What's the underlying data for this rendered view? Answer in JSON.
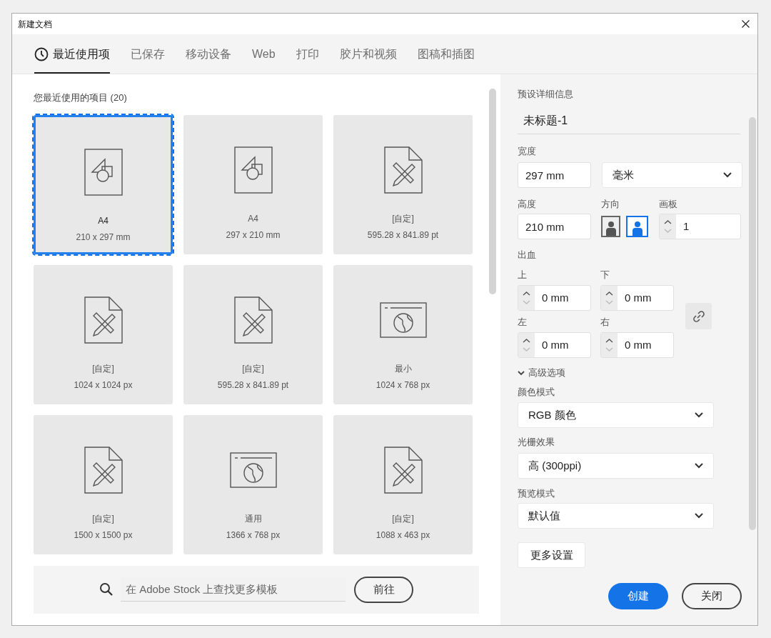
{
  "window": {
    "title": "新建文档"
  },
  "tabs": [
    {
      "label": "最近使用项",
      "selected": true,
      "kind": "recent"
    },
    {
      "label": "已保存",
      "selected": false,
      "kind": "category"
    },
    {
      "label": "移动设备",
      "selected": false,
      "kind": "category"
    },
    {
      "label": "Web",
      "selected": false,
      "kind": "category"
    },
    {
      "label": "打印",
      "selected": false,
      "kind": "category"
    },
    {
      "label": "胶片和视频",
      "selected": false,
      "kind": "category"
    },
    {
      "label": "图稿和插图",
      "selected": false,
      "kind": "category"
    }
  ],
  "recent": {
    "heading": "您最近使用的项目 (20)",
    "items": [
      {
        "kind": "shapes",
        "name": "A4",
        "size": "210 x 297 mm",
        "selected": true
      },
      {
        "kind": "shapes",
        "name": "A4",
        "size": "297 x 210 mm",
        "selected": false
      },
      {
        "kind": "custom",
        "name": "[自定]",
        "size": "595.28 x 841.89 pt",
        "selected": false
      },
      {
        "kind": "custom",
        "name": "[自定]",
        "size": "1024 x 1024 px",
        "selected": false
      },
      {
        "kind": "custom",
        "name": "[自定]",
        "size": "595.28 x 841.89 pt",
        "selected": false
      },
      {
        "kind": "web",
        "name": "最小",
        "size": "1024 x 768 px",
        "selected": false
      },
      {
        "kind": "custom",
        "name": "[自定]",
        "size": "1500 x 1500 px",
        "selected": false
      },
      {
        "kind": "web",
        "name": "通用",
        "size": "1366 x 768 px",
        "selected": false
      },
      {
        "kind": "custom",
        "name": "[自定]",
        "size": "1088 x 463 px",
        "selected": false
      }
    ]
  },
  "stock_search": {
    "placeholder": "在 Adobe Stock 上查找更多模板",
    "button": "前往"
  },
  "preset": {
    "heading": "预设详细信息",
    "name": "未标题-1",
    "width": {
      "label": "宽度",
      "value": "297 mm"
    },
    "units": {
      "value": "毫米"
    },
    "height": {
      "label": "高度",
      "value": "210 mm"
    },
    "orientation": {
      "label": "方向",
      "options": [
        {
          "kind": "portrait",
          "selected": false
        },
        {
          "kind": "landscape",
          "selected": true
        }
      ]
    },
    "artboards": {
      "label": "画板",
      "value": "1"
    },
    "bleed": {
      "label": "出血",
      "fields": [
        {
          "label": "上",
          "value": "0 mm"
        },
        {
          "label": "下",
          "value": "0 mm"
        },
        {
          "label": "左",
          "value": "0 mm"
        },
        {
          "label": "右",
          "value": "0 mm"
        }
      ]
    },
    "advanced": {
      "label": "高级选项",
      "expanded": true
    },
    "color_mode": {
      "label": "颜色模式",
      "value": "RGB 颜色"
    },
    "raster": {
      "label": "光栅效果",
      "value": "高 (300ppi)"
    },
    "preview_mode": {
      "label": "预览模式",
      "value": "默认值"
    },
    "more_settings": "更多设置"
  },
  "buttons": [
    {
      "label": "创建",
      "kind": "primary"
    },
    {
      "label": "关闭",
      "kind": "secondary"
    }
  ]
}
